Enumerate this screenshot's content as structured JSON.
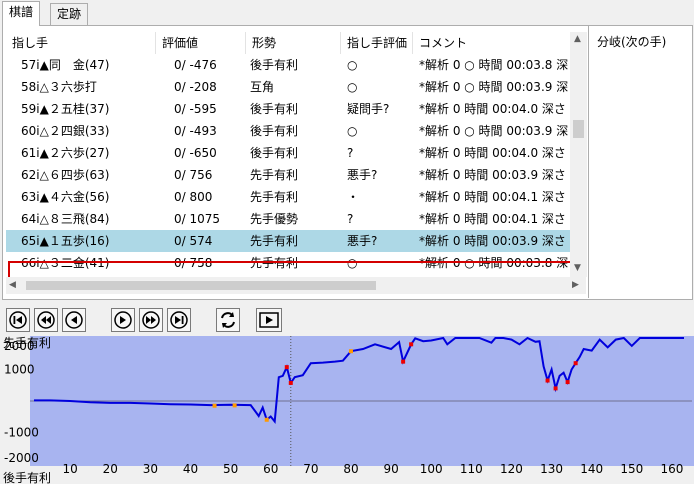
{
  "tabs": [
    "棋譜",
    "定跡"
  ],
  "columns": [
    "指し手",
    "評価値",
    "形勢",
    "指し手評価",
    "コメント"
  ],
  "rows": [
    {
      "move": "57i▲同　金(47)",
      "score": "0/ -476",
      "position": "後手有利",
      "eval": "○",
      "comment": "*解析 0 ○ 時間 00:03.8 深"
    },
    {
      "move": "58i△３六歩打",
      "score": "0/ -208",
      "position": "互角",
      "eval": "○",
      "comment": "*解析 0 ○ 時間 00:03.9 深"
    },
    {
      "move": "59i▲２五桂(37)",
      "score": "0/ -595",
      "position": "後手有利",
      "eval": "疑問手?",
      "comment": "*解析 0  時間 00:04.0 深さ"
    },
    {
      "move": "60i△２四銀(33)",
      "score": "0/ -493",
      "position": "後手有利",
      "eval": "○",
      "comment": "*解析 0 ○ 時間 00:03.9 深"
    },
    {
      "move": "61i▲２六歩(27)",
      "score": "0/ -650",
      "position": "後手有利",
      "eval": "?",
      "comment": "*解析 0  時間 00:04.0 深さ"
    },
    {
      "move": "62i△６四歩(63)",
      "score": "0/  756",
      "position": "先手有利",
      "eval": "悪手?",
      "comment": "*解析 0  時間 00:03.9 深さ"
    },
    {
      "move": "63i▲４六金(56)",
      "score": "0/  800",
      "position": "先手有利",
      "eval": "・",
      "comment": "*解析 0  時間 00:04.1 深さ"
    },
    {
      "move": "64i△８三飛(84)",
      "score": "0/ 1075",
      "position": "先手優勢",
      "eval": "?",
      "comment": "*解析 0  時間 00:04.1 深さ"
    },
    {
      "move": "65i▲１五歩(16)",
      "score": "0/  574",
      "position": "先手有利",
      "eval": "悪手?",
      "comment": "*解析 0  時間 00:03.9 深さ"
    },
    {
      "move": "66i△３二金(41)",
      "score": "0/  758",
      "position": "先手有利",
      "eval": "○",
      "comment": "*解析 0 ○ 時間 00:03.8 深"
    }
  ],
  "selected_row": 8,
  "branch_title": "分岐(次の手)",
  "toolbar": [
    "first-move",
    "back-10",
    "back-1",
    "forward-1",
    "forward-10",
    "last-move",
    "flip-board",
    "play"
  ],
  "chart_data": {
    "type": "line",
    "top_label": "先手有利",
    "bottom_label": "後手有利",
    "ylim": [
      -2000,
      2000
    ],
    "y_ticks": [
      2000,
      1000,
      -1000,
      -2000
    ],
    "x_ticks": [
      10,
      20,
      30,
      40,
      50,
      60,
      70,
      80,
      90,
      100,
      110,
      120,
      130,
      140,
      150,
      160
    ],
    "xlim": [
      0,
      165
    ],
    "current_move": 65,
    "colors": {
      "bg": "#a8b4f0",
      "line": "#0000dd",
      "bad": "#ee0000",
      "dubious": "#ff9900"
    },
    "series": [
      {
        "values": [
          [
            1,
            20
          ],
          [
            5,
            20
          ],
          [
            10,
            0
          ],
          [
            15,
            -40
          ],
          [
            20,
            -60
          ],
          [
            25,
            -60
          ],
          [
            30,
            -80
          ],
          [
            35,
            -100
          ],
          [
            40,
            -110
          ],
          [
            45,
            -130
          ],
          [
            50,
            -120
          ],
          [
            55,
            -130
          ],
          [
            57,
            -476
          ],
          [
            58,
            -208
          ],
          [
            59,
            -595
          ],
          [
            60,
            -493
          ],
          [
            61,
            -650
          ],
          [
            62,
            756
          ],
          [
            63,
            800
          ],
          [
            64,
            1075
          ],
          [
            65,
            574
          ],
          [
            66,
            758
          ],
          [
            68,
            820
          ],
          [
            70,
            1200
          ],
          [
            73,
            1220
          ],
          [
            76,
            1250
          ],
          [
            78,
            1280
          ],
          [
            80,
            1580
          ],
          [
            83,
            1650
          ],
          [
            86,
            1800
          ],
          [
            90,
            1650
          ],
          [
            92,
            1870
          ],
          [
            93,
            1250
          ],
          [
            95,
            1800
          ],
          [
            96,
            1990
          ],
          [
            98,
            1900
          ],
          [
            100,
            1920
          ],
          [
            103,
            2000
          ],
          [
            104,
            1800
          ],
          [
            106,
            2000
          ],
          [
            108,
            2000
          ],
          [
            110,
            2000
          ],
          [
            112,
            2000
          ],
          [
            115,
            1850
          ],
          [
            116,
            2000
          ],
          [
            118,
            2000
          ],
          [
            120,
            1950
          ],
          [
            122,
            1800
          ],
          [
            124,
            2000
          ],
          [
            126,
            1880
          ],
          [
            127,
            1900
          ],
          [
            128,
            1100
          ],
          [
            129,
            650
          ],
          [
            130,
            1000
          ],
          [
            131,
            400
          ],
          [
            132,
            800
          ],
          [
            133,
            900
          ],
          [
            134,
            600
          ],
          [
            135,
            1000
          ],
          [
            136,
            1200
          ],
          [
            137,
            1400
          ],
          [
            138,
            1650
          ],
          [
            140,
            1600
          ],
          [
            142,
            1950
          ],
          [
            144,
            1700
          ],
          [
            146,
            1950
          ],
          [
            148,
            2000
          ],
          [
            150,
            1750
          ],
          [
            152,
            2000
          ],
          [
            155,
            2000
          ],
          [
            160,
            2000
          ],
          [
            163,
            2000
          ]
        ]
      }
    ],
    "bad_moves": [
      [
        64,
        1075
      ],
      [
        65,
        574
      ],
      [
        93,
        1250
      ],
      [
        95,
        1800
      ],
      [
        129,
        650
      ],
      [
        131,
        400
      ],
      [
        134,
        600
      ],
      [
        136,
        1200
      ]
    ],
    "dubious_moves": [
      [
        46,
        -150
      ],
      [
        51,
        -140
      ],
      [
        59,
        -595
      ],
      [
        80,
        1580
      ]
    ]
  }
}
